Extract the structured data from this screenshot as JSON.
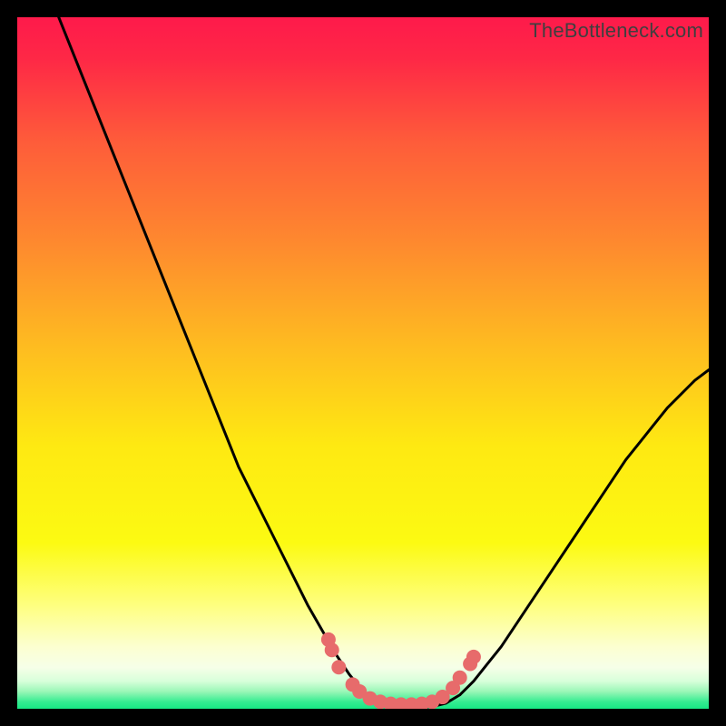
{
  "watermark": "TheBottleneck.com",
  "colors": {
    "frame": "#000000",
    "curve": "#000000",
    "marker": "#e76b6b",
    "green_band": "#17e884",
    "gradient_top": "#fe1a4b",
    "gradient_mid1": "#fe872f",
    "gradient_mid2": "#fee912",
    "gradient_low": "#feff7f",
    "gradient_pale": "#fcffd0"
  },
  "chart_data": {
    "type": "line",
    "title": "",
    "xlabel": "",
    "ylabel": "",
    "xlim": [
      0,
      100
    ],
    "ylim": [
      0,
      100
    ],
    "series": [
      {
        "name": "bottleneck-curve",
        "x": [
          6,
          8,
          10,
          12,
          14,
          16,
          18,
          20,
          22,
          24,
          26,
          28,
          30,
          32,
          34,
          36,
          38,
          40,
          42,
          44,
          46,
          48,
          50,
          52,
          54,
          56,
          58,
          60,
          62,
          64,
          66,
          68,
          70,
          72,
          74,
          76,
          78,
          80,
          82,
          84,
          86,
          88,
          90,
          92,
          94,
          96,
          98,
          100
        ],
        "y": [
          100,
          95,
          90,
          85,
          80,
          75,
          70,
          65,
          60,
          55,
          50,
          45,
          40,
          35,
          31,
          27,
          23,
          19,
          15,
          11.5,
          8,
          5,
          2.5,
          1,
          0.3,
          0.2,
          0.2,
          0.3,
          0.8,
          2,
          4,
          6.5,
          9,
          12,
          15,
          18,
          21,
          24,
          27,
          30,
          33,
          36,
          38.5,
          41,
          43.5,
          45.5,
          47.5,
          49
        ]
      }
    ],
    "markers": [
      {
        "x": 45.0,
        "y": 10.0
      },
      {
        "x": 45.5,
        "y": 8.5
      },
      {
        "x": 46.5,
        "y": 6.0
      },
      {
        "x": 48.5,
        "y": 3.5
      },
      {
        "x": 49.5,
        "y": 2.5
      },
      {
        "x": 51.0,
        "y": 1.5
      },
      {
        "x": 52.5,
        "y": 1.0
      },
      {
        "x": 54.0,
        "y": 0.7
      },
      {
        "x": 55.5,
        "y": 0.6
      },
      {
        "x": 57.0,
        "y": 0.6
      },
      {
        "x": 58.5,
        "y": 0.7
      },
      {
        "x": 60.0,
        "y": 1.0
      },
      {
        "x": 61.5,
        "y": 1.7
      },
      {
        "x": 63.0,
        "y": 3.0
      },
      {
        "x": 64.0,
        "y": 4.5
      },
      {
        "x": 65.5,
        "y": 6.5
      },
      {
        "x": 66.0,
        "y": 7.5
      }
    ]
  }
}
